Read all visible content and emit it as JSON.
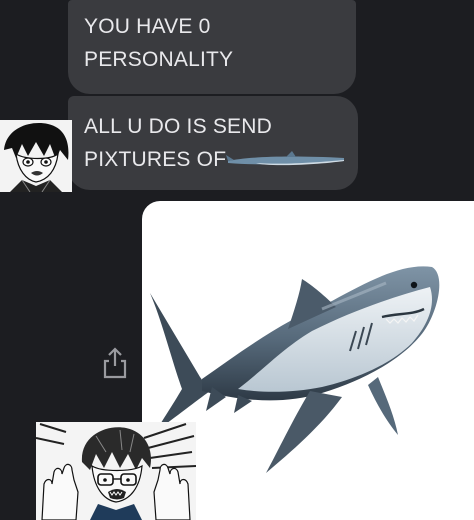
{
  "messages": [
    {
      "line1": "YOU HAVE 0",
      "line2": "PERSONALITY"
    },
    {
      "line1": "ALL U DO IS SEND",
      "line2": "PIXTURES OF"
    }
  ],
  "icons": {
    "share": "share-icon",
    "inline_image": "shark-icon"
  },
  "colors": {
    "background": "#1c1d21",
    "bubble": "#3a3b3f",
    "text": "#e9e9ec"
  }
}
